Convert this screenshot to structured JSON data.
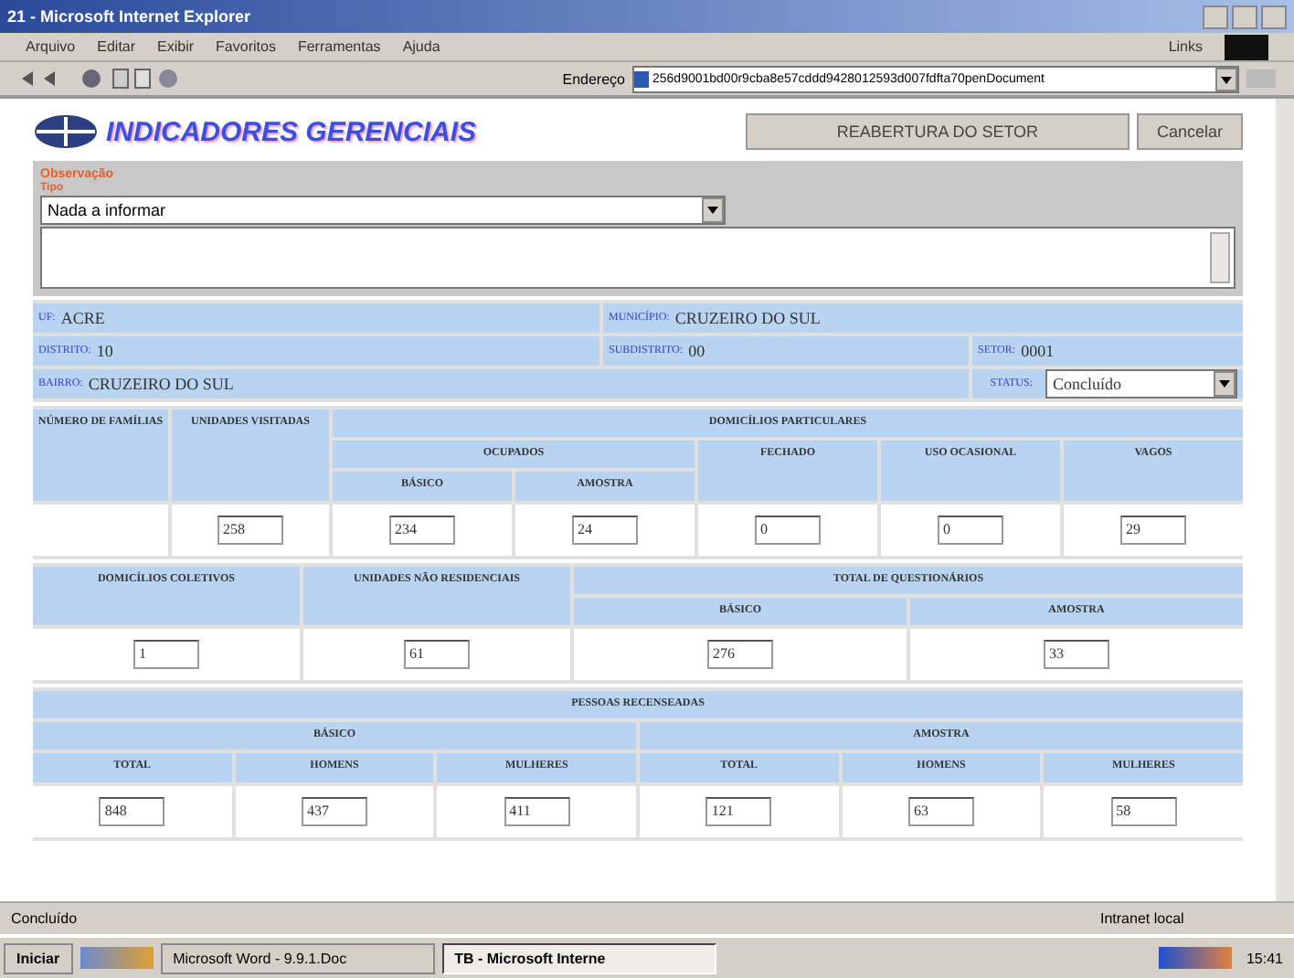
{
  "window": {
    "title": "21 - Microsoft Internet Explorer"
  },
  "menu": [
    "Arquivo",
    "Editar",
    "Exibir",
    "Favoritos",
    "Ferramentas",
    "Ajuda"
  ],
  "address": {
    "label": "Endereço",
    "value": "256d9001bd00r9cba8e57cddd9428012593d007fdfta70penDocument",
    "links": "Links"
  },
  "page": {
    "title": "INDICADORES GERENCIAIS",
    "buttons": [
      "REABERTURA DO SETOR",
      "Cancelar"
    ],
    "obs": {
      "label": "Observação",
      "sublabel": "Tipo",
      "select": "Nada a informar"
    },
    "info": [
      {
        "label": "UF:",
        "value": "ACRE"
      },
      {
        "label": "MUNICÍPIO:",
        "value": "CRUZEIRO DO SUL"
      },
      {
        "label": "DISTRITO:",
        "value": "10"
      },
      {
        "label": "SUBDISTRITO:",
        "value": "00"
      },
      {
        "label": "SETOR:",
        "value": "0001"
      },
      {
        "label": "BAIRRO:",
        "value": "CRUZEIRO DO SUL"
      },
      {
        "label": "STATUS:",
        "value": "Concluído"
      }
    ],
    "t1": {
      "headers": [
        "NÚMERO DE FAMÍLIAS",
        "UNIDADES VISITADAS",
        "DOMICÍLIOS PARTICULARES",
        "OCUPADOS",
        "FECHADO",
        "USO OCASIONAL",
        "VAGOS",
        "BÁSICO",
        "AMOSTRA"
      ],
      "values": [
        "258",
        "234",
        "24",
        "0",
        "0",
        "29"
      ]
    },
    "t2": {
      "headers": [
        "DOMICÍLIOS COLETIVOS",
        "UNIDADES NÃO RESIDENCIAIS",
        "TOTAL DE QUESTIONÁRIOS",
        "BÁSICO",
        "AMOSTRA"
      ],
      "values": [
        "1",
        "61",
        "276",
        "33"
      ]
    },
    "t3": {
      "headers": [
        "PESSOAS RECENSEADAS",
        "BÁSICO",
        "AMOSTRA"
      ],
      "sub": [
        "TOTAL",
        "HOMENS",
        "MULHERES",
        "TOTAL",
        "HOMENS",
        "MULHERES"
      ],
      "values": [
        "848",
        "437",
        "411",
        "121",
        "63",
        "58"
      ]
    }
  },
  "status_bar": {
    "text": "Concluído",
    "zone": "Intranet local"
  },
  "taskbar": {
    "start": "Iniciar",
    "tasks": [
      {
        "label": "Microsoft Word - 9.9.1.Doc",
        "selected": false
      },
      {
        "label": "TB - Microsoft Interne",
        "selected": true
      }
    ],
    "time": "15:41"
  }
}
